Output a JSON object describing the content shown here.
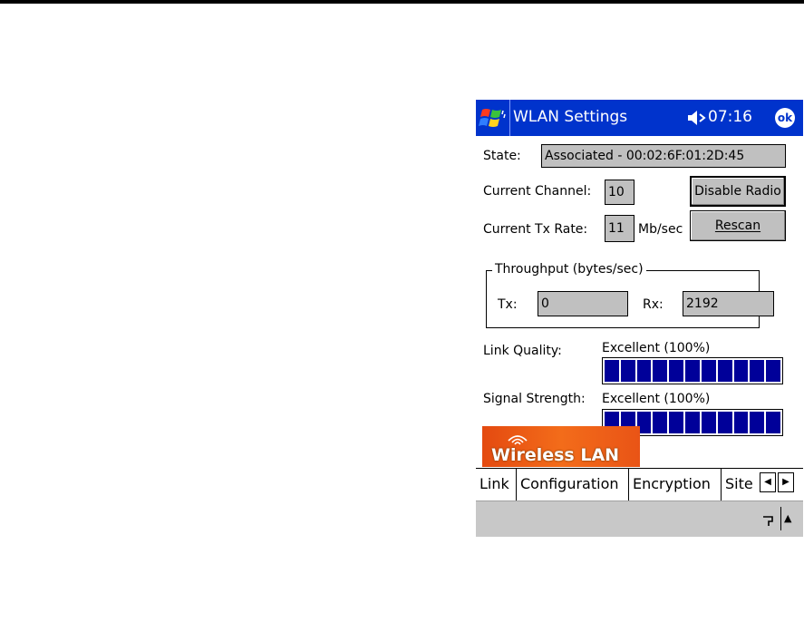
{
  "window": {
    "title": "WLAN Settings",
    "clock": "07:16",
    "ok_label": "ok",
    "icons": {
      "start": "windows-flag-icon",
      "volume": "speaker-muted-icon"
    }
  },
  "link": {
    "state_label": "State:",
    "state_value": "Associated - 00:02:6F:01:2D:45",
    "channel_label": "Current Channel:",
    "channel_value": "10",
    "txrate_label": "Current Tx Rate:",
    "txrate_value": "11",
    "txrate_unit": "Mb/sec",
    "disable_radio_label": "Disable Radio",
    "rescan_label": "Rescan",
    "throughput": {
      "title": "Throughput (bytes/sec)",
      "tx_label": "Tx:",
      "tx_value": "0",
      "rx_label": "Rx:",
      "rx_value": "2192"
    },
    "link_quality_label": "Link Quality:",
    "link_quality_value": "Excellent (100%)",
    "link_quality_level": 1.0,
    "signal_strength_label": "Signal Strength:",
    "signal_strength_value": "Excellent (100%)",
    "signal_strength_level": 1.0
  },
  "banner": {
    "text": "Wireless LAN"
  },
  "tabs": [
    {
      "label": "Link",
      "active": true
    },
    {
      "label": "Configuration",
      "active": false
    },
    {
      "label": "Encryption",
      "active": false
    },
    {
      "label": "Site",
      "active": false
    }
  ],
  "colors": {
    "titlebar": "#0033cc",
    "meter": "#000099",
    "banner": "#e95416"
  }
}
